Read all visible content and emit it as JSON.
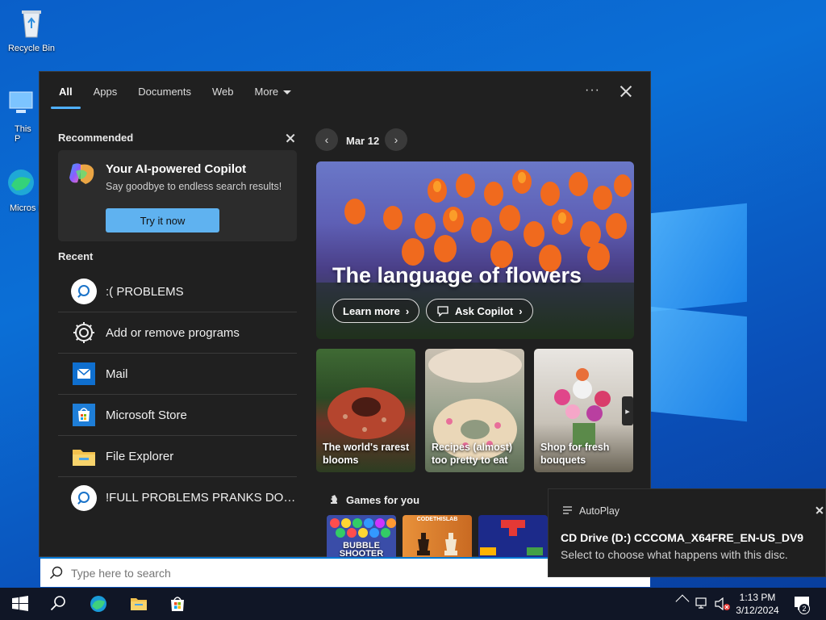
{
  "desktop": {
    "icons": [
      {
        "label": "Recycle Bin"
      },
      {
        "label": "This P"
      },
      {
        "label": "Micros Edge"
      }
    ]
  },
  "panel": {
    "tabs": [
      "All",
      "Apps",
      "Documents",
      "Web",
      "More"
    ],
    "active_tab": "All",
    "more_icon": "ellipsis-icon",
    "close_icon": "close-icon",
    "recommended": {
      "title": "Recommended",
      "card_title": "Your AI-powered Copilot",
      "card_subtitle": "Say goodbye to endless search results!",
      "button": "Try it now"
    },
    "recent": {
      "title": "Recent",
      "items": [
        {
          "label": ":( PROBLEMS",
          "icon": "search-icon"
        },
        {
          "label": "Add or remove programs",
          "icon": "gear-icon"
        },
        {
          "label": "Mail",
          "icon": "mail-icon"
        },
        {
          "label": "Microsoft Store",
          "icon": "store-icon"
        },
        {
          "label": "File Explorer",
          "icon": "folder-icon"
        },
        {
          "label": "!FULL PROBLEMS PRANKS DOCU...",
          "icon": "search-icon"
        }
      ]
    },
    "highlights": {
      "date": "Mar 12",
      "hero_title": "The language of flowers",
      "learn_more": "Learn more",
      "ask_copilot": "Ask Copilot",
      "tiles": [
        {
          "caption": "The world's rarest blooms"
        },
        {
          "caption": "Recipes (almost) too pretty to eat"
        },
        {
          "caption": "Shop for fresh bouquets"
        }
      ],
      "games_title": "Games for you",
      "games": [
        {
          "label": "BUBBLE SHOOTER"
        },
        {
          "label": "CODETHISLAB"
        },
        {
          "label": ""
        }
      ]
    }
  },
  "searchbar": {
    "placeholder": "Type here to search"
  },
  "toast": {
    "app": "AutoPlay",
    "title": "CD Drive (D:) CCCOMA_X64FRE_EN-US_DV9",
    "body": "Select to choose what happens with this disc."
  },
  "taskbar": {
    "time": "1:13 PM",
    "date": "3/12/2024",
    "notification_count": "2"
  }
}
